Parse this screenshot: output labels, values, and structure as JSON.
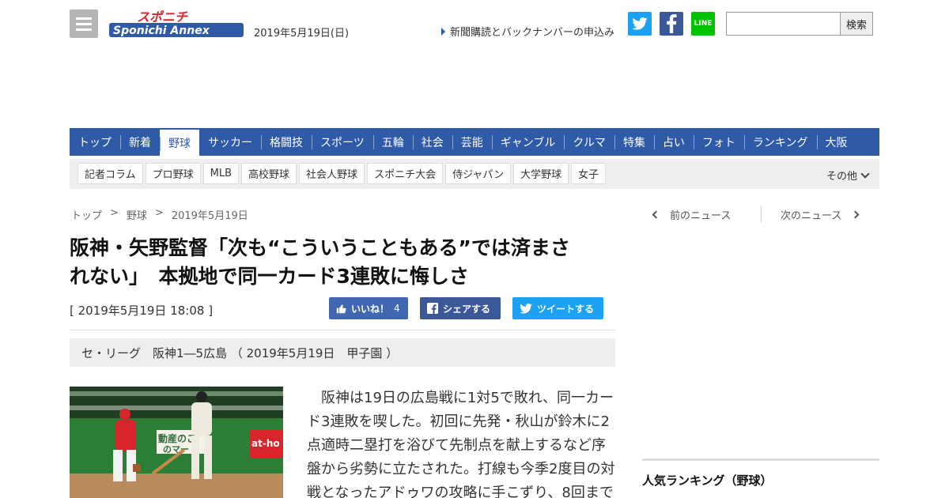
{
  "header": {
    "menu_icon": "hamburger-icon",
    "logo_top": "スポニチ",
    "logo_bottom": "Sponichi Annex",
    "date": "2019年5月19日(日)",
    "subscribe_link": "新聞購読とバックナンバーの申込み",
    "social": {
      "twitter_icon": "twitter-icon",
      "facebook_icon": "facebook-icon",
      "line_label": "LINE"
    },
    "search": {
      "value": "",
      "button_label": "検索"
    }
  },
  "main_nav": {
    "items": [
      "トップ",
      "新着",
      "野球",
      "サッカー",
      "格闘技",
      "スポーツ",
      "五輪",
      "社会",
      "芸能",
      "ギャンブル",
      "クルマ",
      "特集",
      "占い",
      "フォト",
      "ランキング",
      "大阪"
    ],
    "active": "野球"
  },
  "sub_nav": {
    "items": [
      "記者コラム",
      "プロ野球",
      "MLB",
      "高校野球",
      "社会人野球",
      "スポニチ大会",
      "侍ジャパン",
      "大学野球",
      "女子"
    ],
    "other_label": "その他"
  },
  "breadcrumb": {
    "items": [
      "トップ",
      "野球",
      "2019年5月19日"
    ],
    "separator": ">"
  },
  "pager": {
    "prev": "前のニュース",
    "next": "次のニュース"
  },
  "article": {
    "headline_line1": "阪神・矢野監督「次も“こういうこともある”では済まさ",
    "headline_line2": "れない」　本拠地で同一カード3連敗に悔しさ",
    "published": "[ 2019年5月19日 18:08 ]",
    "share": {
      "like_label": "いいね！",
      "like_count": "4",
      "share_label": "シェアする",
      "tweet_label": "ツイートする"
    },
    "game_info": "セ・リーグ　阪神1―5広島 （ 2019年5月19日　甲子園 ）",
    "photo_sign_left": "動産のこ",
    "photo_sign_left2": "のマー",
    "photo_sign_right": "at-ho",
    "body": "阪神は19日の広島戦に1対5で敗れ、同一カード3連敗を喫した。初回に先発・秋山が鈴木に2点適時二塁打を浴びて先制点を献上するなど序盤から劣勢に立たされた。打線も今季2度目の対戦となったアドゥワの攻略に手こずり、8回まで"
  },
  "sidebar": {
    "ranking_title": "人気ランキング（野球）"
  },
  "colors": {
    "nav_blue": "#2f5aa8",
    "twitter": "#1da1f2",
    "facebook": "#3b5998",
    "line": "#00c300"
  }
}
